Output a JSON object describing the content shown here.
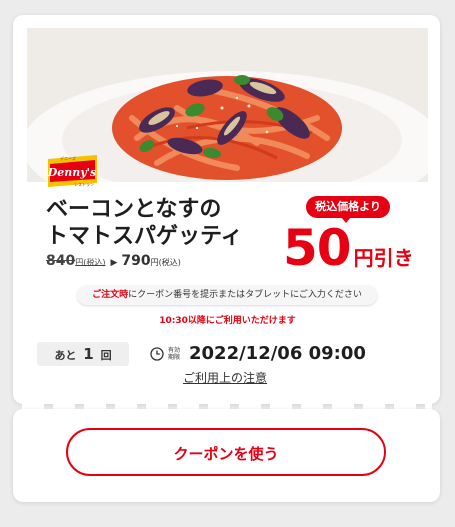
{
  "brand": {
    "logo_text": "Denny's",
    "logo_top_text": "デニーズ",
    "logo_bottom_text": "レストラン",
    "colors": {
      "red": "#e60012",
      "yellow": "#f5c200"
    }
  },
  "coupon": {
    "title_line1": "ベーコンとなすの",
    "title_line2": "トマトスパゲッティ",
    "old_price": "840",
    "old_price_suffix": "円(税込)",
    "new_price": "790",
    "new_price_suffix": "円(税込)",
    "badge": "税込価格より",
    "discount_number": "50",
    "discount_unit": "円引き",
    "note_highlight": "ご注文時",
    "note_rest": "にクーポン番号を提示またはタブレットにご入力ください",
    "time_note": "10:30以降にご利用いただけます",
    "remaining_prefix": "あと",
    "remaining_count": "1",
    "remaining_suffix": "回",
    "expiry_label_top": "有効",
    "expiry_label_bottom": "期限",
    "expiry_date": "2022/12/06 09:00",
    "caution_link": "ご利用上の注意"
  },
  "actions": {
    "use_button": "クーポンを使う"
  },
  "icons": {
    "clock": "clock-icon",
    "arrow": "triangle-right-icon"
  }
}
